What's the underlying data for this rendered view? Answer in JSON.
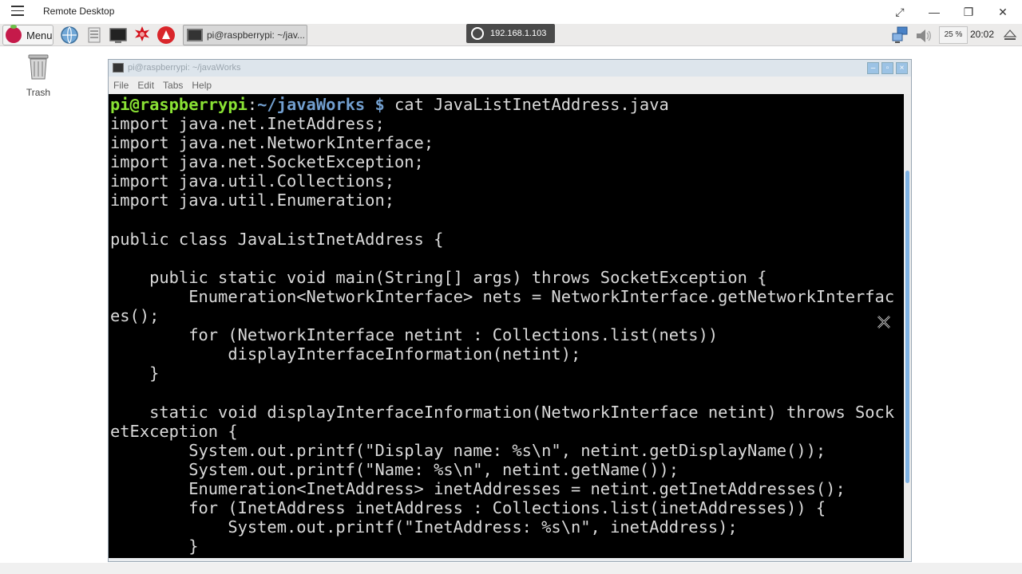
{
  "remote_desktop": {
    "title": "Remote Desktop",
    "controls": {
      "fullscreen": "⤢",
      "minimize": "—",
      "restore": "❐",
      "close": "✕"
    }
  },
  "panel": {
    "menu_label": "Menu",
    "task_button_label": "pi@raspberrypi: ~/jav...",
    "ip_address": "192.168.1.103",
    "cpu_usage": "25 %",
    "clock": "20:02"
  },
  "desktop": {
    "trash_label": "Trash"
  },
  "terminal": {
    "title": "pi@raspberrypi: ~/javaWorks",
    "menu": [
      "File",
      "Edit",
      "Tabs",
      "Help"
    ],
    "prompt_user": "pi@raspberrypi",
    "prompt_sep": ":",
    "prompt_path": "~/javaWorks $",
    "prompt_command": " cat JavaListInetAddress.java",
    "lines": [
      "import java.net.InetAddress;",
      "import java.net.NetworkInterface;",
      "import java.net.SocketException;",
      "import java.util.Collections;",
      "import java.util.Enumeration;",
      "",
      "public class JavaListInetAddress {",
      "",
      "    public static void main(String[] args) throws SocketException {",
      "        Enumeration<NetworkInterface> nets = NetworkInterface.getNetworkInterfac",
      "es();",
      "        for (NetworkInterface netint : Collections.list(nets))",
      "            displayInterfaceInformation(netint);",
      "    }",
      "",
      "    static void displayInterfaceInformation(NetworkInterface netint) throws Sock",
      "etException {",
      "        System.out.printf(\"Display name: %s\\n\", netint.getDisplayName());",
      "        System.out.printf(\"Name: %s\\n\", netint.getName());",
      "        Enumeration<InetAddress> inetAddresses = netint.getInetAddresses();",
      "        for (InetAddress inetAddress : Collections.list(inetAddresses)) {",
      "            System.out.printf(\"InetAddress: %s\\n\", inetAddress);",
      "        }"
    ]
  },
  "icons": {
    "hamburger": "menu-icon",
    "raspberry": "raspberry-icon",
    "browser": "globe-icon",
    "file_manager": "file-manager-icon",
    "terminal": "terminal-icon",
    "math": "mathematica-icon",
    "wolfram": "wolfram-icon",
    "network": "network-icon",
    "volume": "volume-icon",
    "eject": "eject-icon",
    "trash": "trash-icon",
    "cursor": "cursor-icon"
  }
}
